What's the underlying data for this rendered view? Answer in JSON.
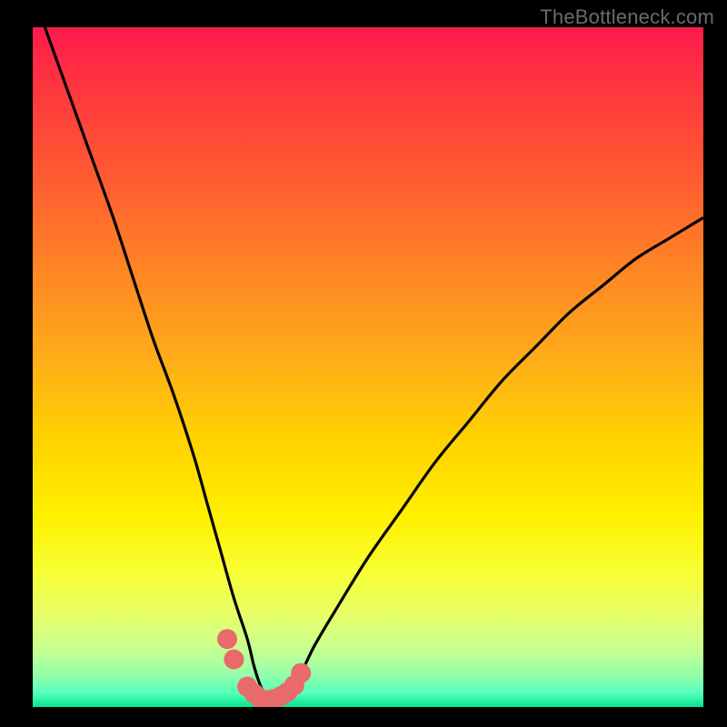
{
  "watermark": "TheBottleneck.com",
  "chart_data": {
    "type": "line",
    "title": "",
    "xlabel": "",
    "ylabel": "",
    "xlim": [
      0,
      100
    ],
    "ylim": [
      0,
      100
    ],
    "grid": false,
    "legend": false,
    "series": [
      {
        "name": "bottleneck-curve",
        "x": [
          0,
          4,
          8,
          12,
          15,
          18,
          21,
          24,
          26,
          28,
          30,
          32,
          33,
          34,
          35,
          36,
          38,
          40,
          42,
          45,
          50,
          55,
          60,
          65,
          70,
          75,
          80,
          85,
          90,
          95,
          100
        ],
        "y": [
          105,
          94,
          83,
          72,
          63,
          54,
          46,
          37,
          30,
          23,
          16,
          10,
          6,
          3,
          1,
          1,
          2,
          5,
          9,
          14,
          22,
          29,
          36,
          42,
          48,
          53,
          58,
          62,
          66,
          69,
          72
        ]
      }
    ],
    "markers": {
      "name": "highlight-dots",
      "x": [
        29,
        30,
        32,
        33,
        34,
        35,
        36,
        37,
        38,
        39,
        40
      ],
      "y": [
        10,
        7,
        3,
        2,
        1.2,
        1,
        1.2,
        1.6,
        2.2,
        3.2,
        5
      ],
      "color": "#e96a6a",
      "size": 11
    },
    "palette": {
      "curve": "#000000",
      "marker": "#e96a6a",
      "bg_top": "#ff1a4d",
      "bg_mid": "#fff000",
      "bg_bot": "#00e68c",
      "frame": "#000000"
    }
  }
}
